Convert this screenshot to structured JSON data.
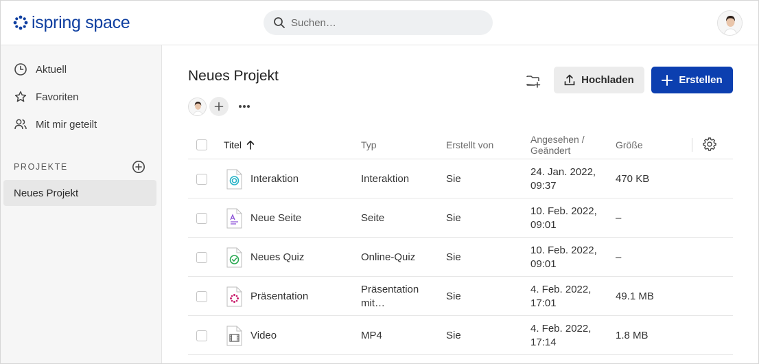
{
  "app": {
    "brand": "ispring space",
    "colors": {
      "accent": "#0c3fb0",
      "brand": "#0f3fa0"
    }
  },
  "search": {
    "placeholder": "Suchen…",
    "icon": "search-icon"
  },
  "sidebar": {
    "items": [
      {
        "label": "Aktuell",
        "icon": "clock-icon"
      },
      {
        "label": "Favoriten",
        "icon": "star-icon"
      },
      {
        "label": "Mit mir geteilt",
        "icon": "users-icon"
      }
    ],
    "section_label": "PROJEKTE",
    "projects": [
      {
        "label": "Neues Projekt",
        "selected": true
      }
    ]
  },
  "main": {
    "title": "Neues Projekt",
    "toolbar": {
      "upload_label": "Hochladen",
      "create_label": "Erstellen"
    }
  },
  "table": {
    "columns": {
      "title": "Titel",
      "type": "Typ",
      "author": "Erstellt von",
      "seen": "Angesehen / Geändert",
      "size": "Größe"
    },
    "sort": {
      "column": "title",
      "direction": "asc"
    },
    "rows": [
      {
        "icon": "interaction-file-icon",
        "title": "Interaktion",
        "type": "Interaktion",
        "author": "Sie",
        "seen": "24. Jan. 2022, 09:37",
        "size": "470 KB"
      },
      {
        "icon": "page-file-icon",
        "title": "Neue Seite",
        "type": "Seite",
        "author": "Sie",
        "seen": "10. Feb. 2022, 09:01",
        "size": "–"
      },
      {
        "icon": "quiz-file-icon",
        "title": "Neues Quiz",
        "type": "Online-Quiz",
        "author": "Sie",
        "seen": "10. Feb. 2022, 09:01",
        "size": "–"
      },
      {
        "icon": "presentation-file-icon",
        "title": "Präsentation",
        "type": "Präsentation mit…",
        "author": "Sie",
        "seen": "4. Feb. 2022, 17:01",
        "size": "49.1 MB"
      },
      {
        "icon": "video-file-icon",
        "title": "Video",
        "type": "MP4",
        "author": "Sie",
        "seen": "4. Feb. 2022, 17:14",
        "size": "1.8 MB"
      }
    ]
  }
}
